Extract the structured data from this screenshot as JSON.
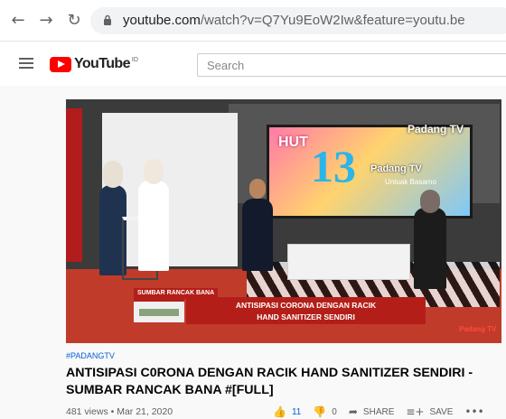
{
  "browser": {
    "url_host": "youtube.com",
    "url_path": "/watch?v=Q7Yu9EoW2Iw&feature=youtu.be",
    "back_icon": "arrow-left-icon",
    "forward_icon": "arrow-right-icon",
    "reload_icon": "reload-icon"
  },
  "masthead": {
    "logo_text": "YouTube",
    "logo_region": "ID",
    "search_placeholder": "Search"
  },
  "video": {
    "screen_hut": "HUT",
    "screen_number": "13",
    "screen_brand": "Padang TV",
    "screen_slogan": "Untuak Basamo",
    "channel_bug": "Padang TV",
    "lower_third_tag": "SUMBAR RANCAK BANA",
    "lower_third_line1": "ANTISIPASI CORONA DENGAN RACIK",
    "lower_third_line2": "HAND SANITIZER SENDIRI",
    "watermark": "Padang TV"
  },
  "meta": {
    "hashtag": "#PADANGTV",
    "title": "ANTISIPASI C0RONA DENGAN RACIK HAND SANITIZER SENDIRI - SUMBAR RANCAK BANA #[FULL]",
    "views_date": "481 views • Mar 21, 2020",
    "likes": "11",
    "dislikes": "0",
    "share_label": "SHARE",
    "save_label": "SAVE"
  },
  "colors": {
    "youtube_red": "#ff0000",
    "link_blue": "#065fd4",
    "lower_third_red": "#b31f18"
  }
}
